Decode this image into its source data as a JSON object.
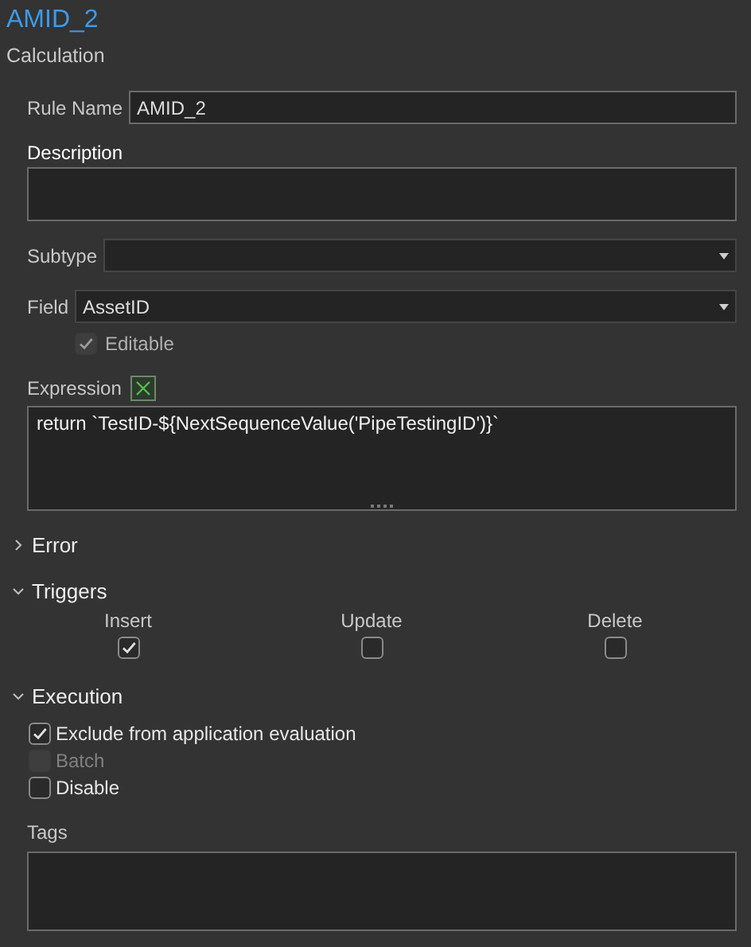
{
  "header": {
    "title": "AMID_2",
    "subtitle": "Calculation"
  },
  "rule_name": {
    "label": "Rule Name",
    "value": "AMID_2"
  },
  "description": {
    "label": "Description"
  },
  "subtype": {
    "label": "Subtype"
  },
  "field": {
    "label": "Field",
    "value": "AssetID"
  },
  "editable": {
    "label": "Editable",
    "checked": true,
    "disabled": true
  },
  "expression": {
    "label": "Expression",
    "code": "return `TestID-${NextSequenceValue('PipeTestingID')}`"
  },
  "sections": [
    {
      "title": "Error",
      "expanded": false
    },
    {
      "title": "Triggers",
      "expanded": true
    },
    {
      "title": "Execution",
      "expanded": true
    }
  ],
  "triggers": [
    {
      "label": "Insert",
      "checked": true
    },
    {
      "label": "Update",
      "checked": false
    },
    {
      "label": "Delete",
      "checked": false
    }
  ],
  "execution": [
    {
      "label": "Exclude from application evaluation",
      "checked": true,
      "disabled": false
    },
    {
      "label": "Batch",
      "checked": false,
      "disabled": true
    },
    {
      "label": "Disable",
      "checked": false,
      "disabled": false
    }
  ],
  "tags": {
    "label": "Tags"
  }
}
